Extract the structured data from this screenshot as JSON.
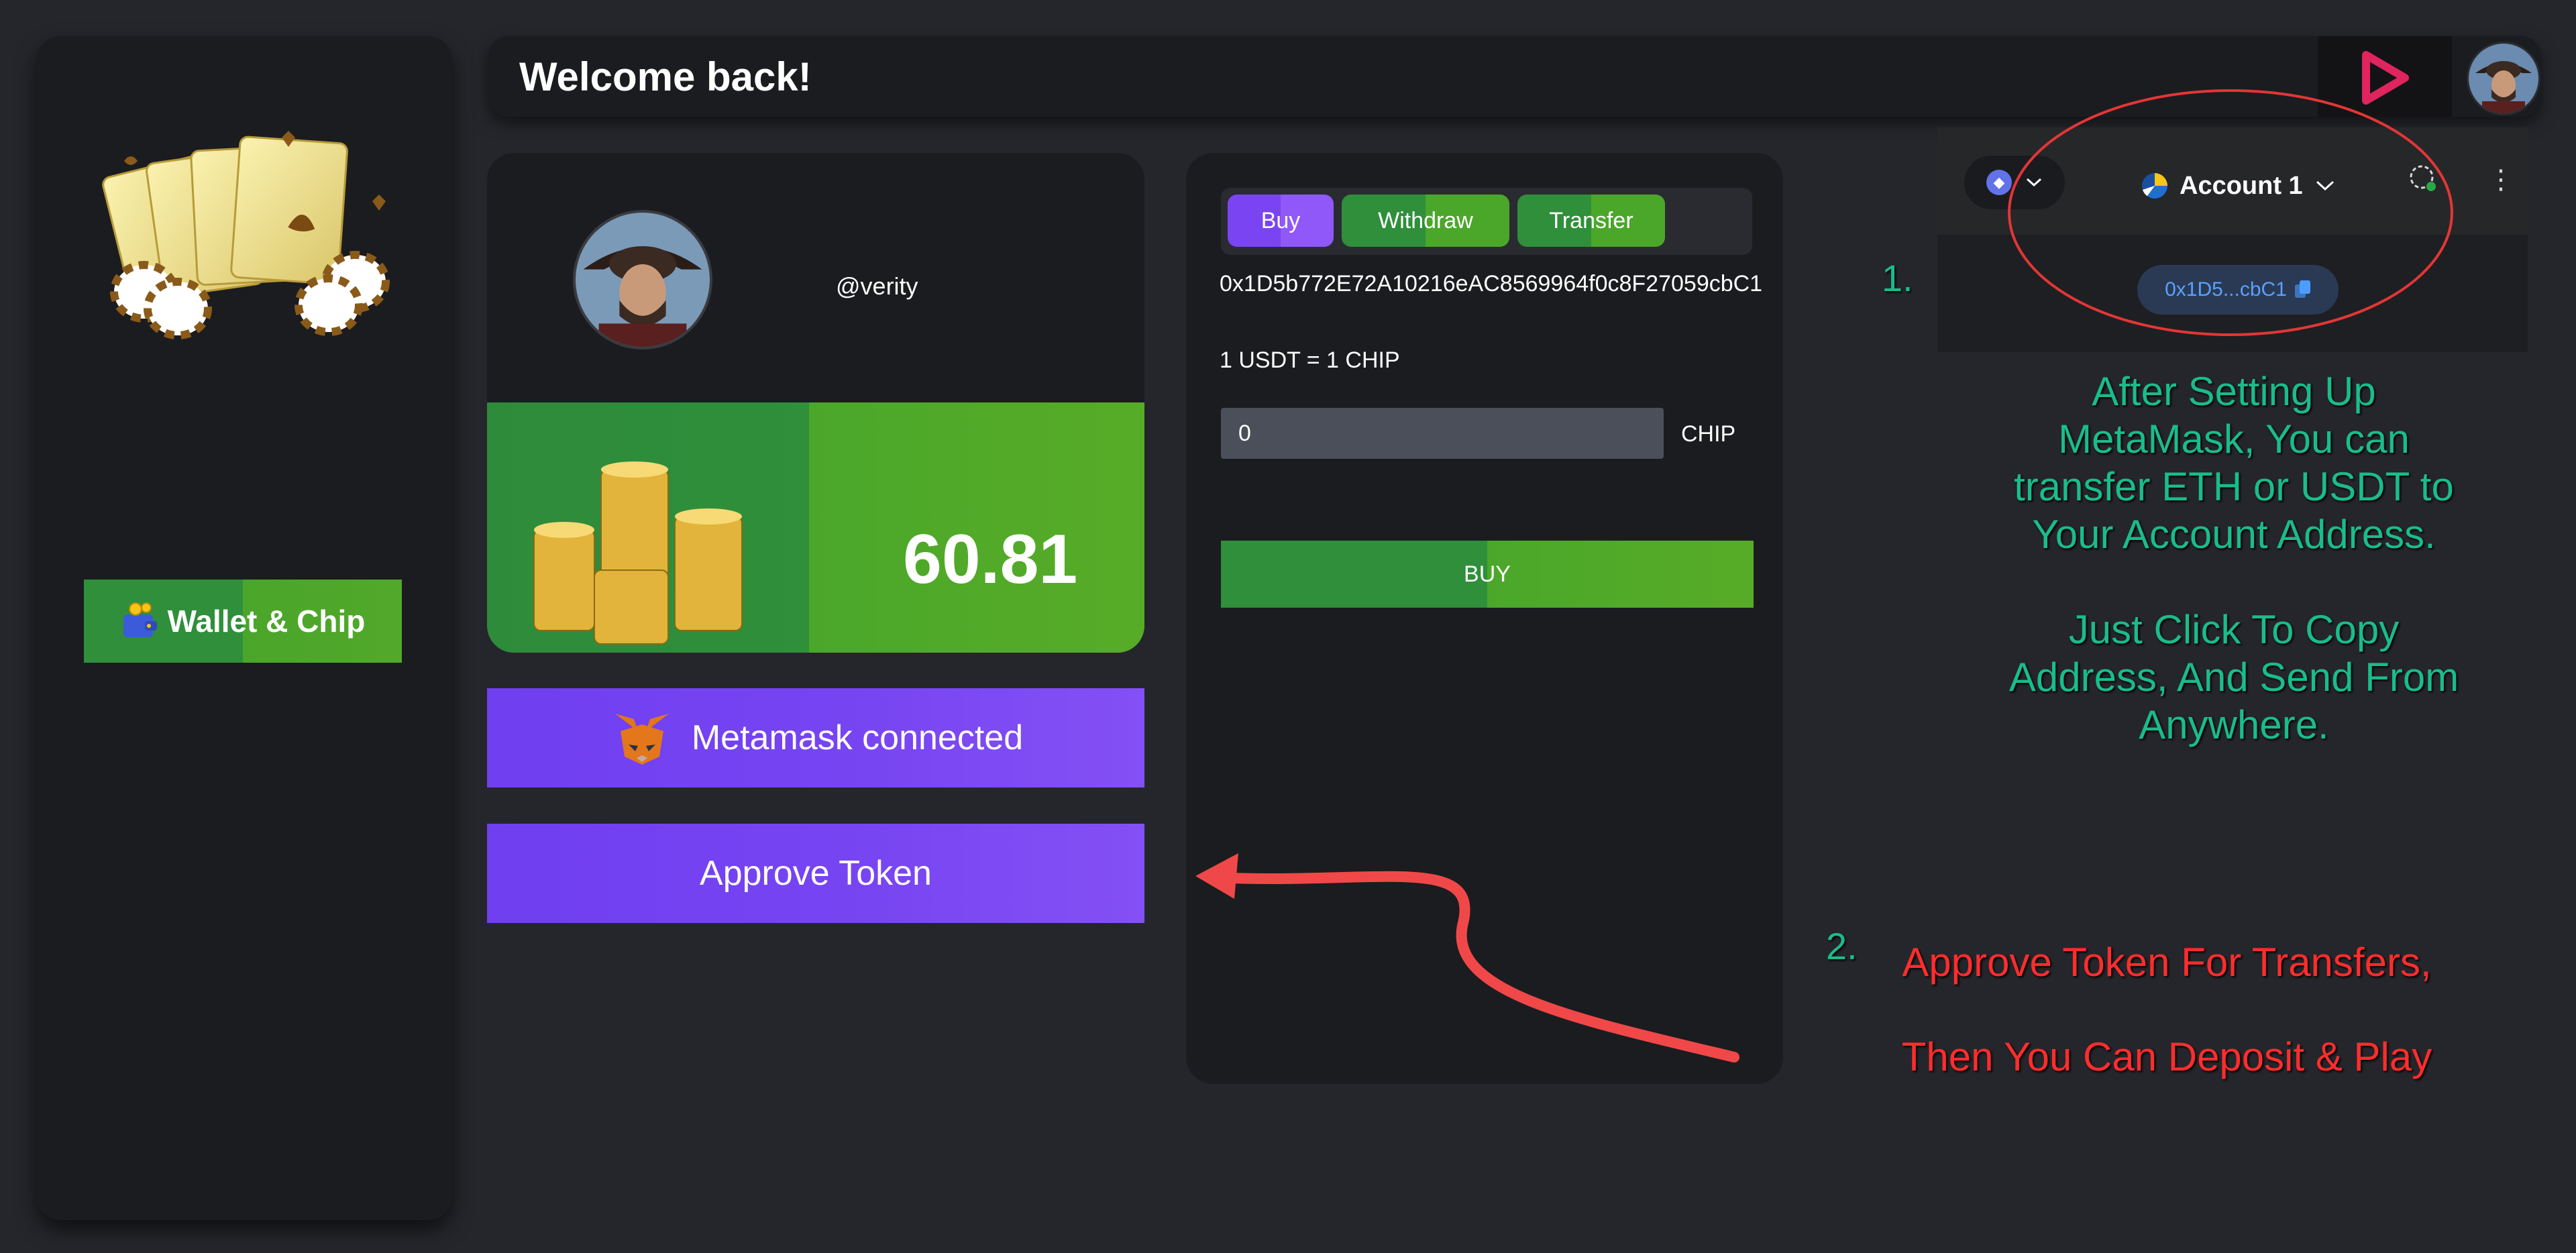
{
  "header": {
    "title": "Welcome back!"
  },
  "sidebar": {
    "wallet_button_label": "Wallet & Chip"
  },
  "profile": {
    "handle": "@verity",
    "balance": "60.81"
  },
  "buttons": {
    "metamask": "Metamask connected",
    "approve": "Approve Token"
  },
  "trade": {
    "tabs": [
      "Buy",
      "Withdraw",
      "Transfer"
    ],
    "address": "0x1D5b772E72A10216eAC8569964f0c8F27059cbC1",
    "rate": "1 USDT = 1 CHIP",
    "amount_value": "0",
    "unit": "CHIP",
    "buy_label": "BUY"
  },
  "metamask": {
    "account_name": "Account 1",
    "short_address": "0x1D5...cbC1",
    "menu_glyph": "⋮"
  },
  "annotations": {
    "step1_number": "1.",
    "step1_lines": [
      "After Setting Up",
      "MetaMask, You can",
      "transfer ETH or USDT to",
      "Your Account Address.",
      "",
      "Just Click To Copy",
      "Address, And Send From",
      "Anywhere."
    ],
    "step2_number": "2.",
    "step2_line1": "Approve Token For Transfers,",
    "step2_line2": "Then You Can Deposit & Play"
  },
  "colors": {
    "background": "#25262b",
    "card": "#1b1c1f",
    "green_accent": "#4ba72a",
    "purple_accent": "#7744f2",
    "annotation_teal": "#1abc8a",
    "annotation_red": "#ff2d2d",
    "brand_play": "#e0245e"
  },
  "icons": [
    "cards-chips-logo",
    "wallet-icon",
    "play-logo-icon",
    "avatar",
    "coins-icon",
    "fox-icon",
    "eth-icon",
    "chevron-down-icon",
    "copy-icon",
    "globe-icon",
    "kebab-menu-icon"
  ]
}
